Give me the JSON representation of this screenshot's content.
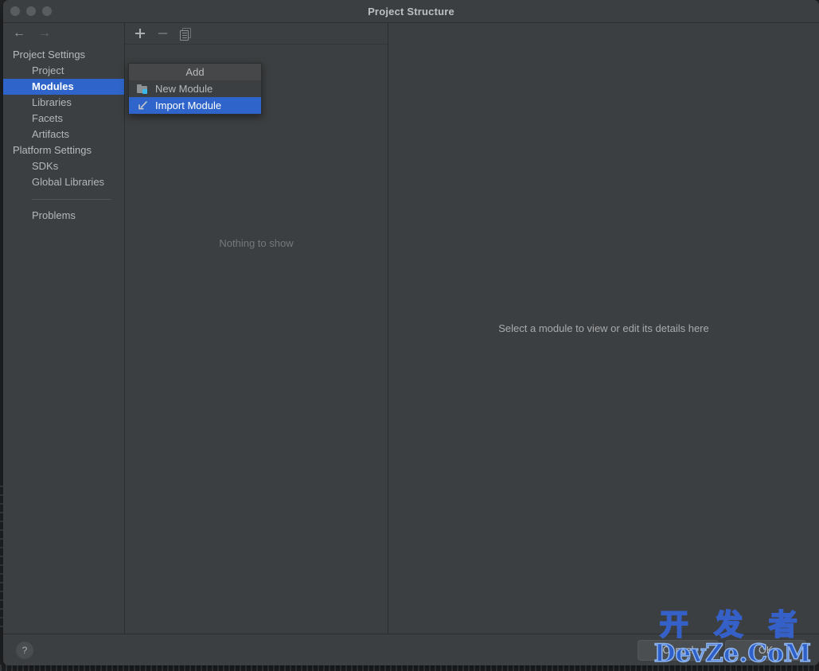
{
  "window": {
    "title": "Project Structure",
    "traffic_lights": [
      "close-button",
      "minimize-button",
      "maximize-button"
    ]
  },
  "navigation": {
    "back_icon": "←",
    "forward_icon": "→"
  },
  "sidebar": {
    "groups": [
      {
        "label": "Project Settings",
        "items": [
          {
            "label": "Project",
            "selected": false
          },
          {
            "label": "Modules",
            "selected": true
          },
          {
            "label": "Libraries",
            "selected": false
          },
          {
            "label": "Facets",
            "selected": false
          },
          {
            "label": "Artifacts",
            "selected": false
          }
        ]
      },
      {
        "label": "Platform Settings",
        "items": [
          {
            "label": "SDKs",
            "selected": false
          },
          {
            "label": "Global Libraries",
            "selected": false
          }
        ]
      }
    ],
    "extra": {
      "label": "Problems"
    }
  },
  "middle_panel": {
    "toolbar": [
      {
        "name": "add-button",
        "icon": "plus-icon",
        "enabled": true
      },
      {
        "name": "remove-button",
        "icon": "minus-icon",
        "enabled": false
      },
      {
        "name": "copy-button",
        "icon": "copy-icon",
        "enabled": true
      }
    ],
    "empty_text": "Nothing to show"
  },
  "right_panel": {
    "message": "Select a module to view or edit its details here"
  },
  "add_menu": {
    "header": "Add",
    "items": [
      {
        "label": "New Module",
        "icon": "folder-new-icon",
        "highlighted": false
      },
      {
        "label": "Import Module",
        "icon": "import-arrow-icon",
        "highlighted": true
      }
    ]
  },
  "bottom_bar": {
    "help_label": "?",
    "cancel_label": "Cancel",
    "ok_label": "OK"
  },
  "watermark": {
    "line1": "开 发 者",
    "line2": "DevZe.CoM"
  },
  "colors": {
    "window_bg": "#3c3f41",
    "accent_selection": "#2f65ca",
    "badge_cyan": "#3ab8e8",
    "border": "#2b2d2f",
    "text_primary": "#b4b6b8",
    "text_muted": "#75787a",
    "watermark_blue": "#2f5fc9"
  }
}
